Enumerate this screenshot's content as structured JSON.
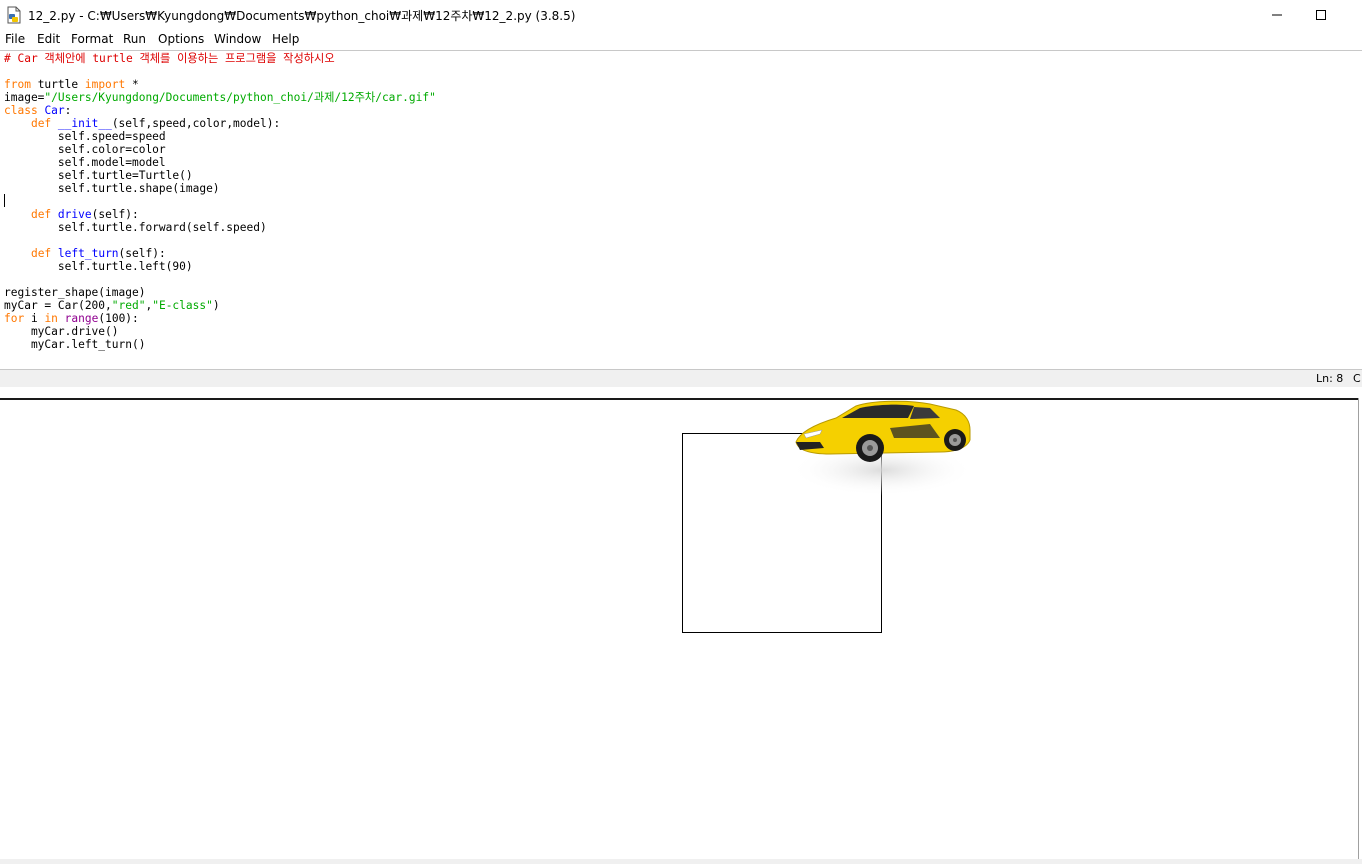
{
  "window": {
    "title": "12_2.py - C:₩Users₩Kyungdong₩Documents₩python_choi₩과제₩12주차₩12_2.py (3.8.5)",
    "minimize_symbol": "—",
    "maximize_symbol": "☐"
  },
  "menu": {
    "items": [
      "File",
      "Edit",
      "Format",
      "Run",
      "Options",
      "Window",
      "Help"
    ]
  },
  "code": {
    "lines": [
      "# Car 객체안에 turtle 객체를 이용하는 프로그램을 작성하시오",
      "",
      "from turtle import *",
      "image=\"/Users/Kyungdong/Documents/python_choi/과제/12주차/car.gif\"",
      "class Car:",
      "    def __init__(self,speed,color,model):",
      "        self.speed=speed",
      "        self.color=color",
      "        self.model=model",
      "        self.turtle=Turtle()",
      "        self.turtle.shape(image)",
      "",
      "    def drive(self):",
      "        self.turtle.forward(self.speed)",
      "",
      "    def left_turn(self):",
      "        self.turtle.left(90)",
      "",
      "register_shape(image)",
      "myCar = Car(200,\"red\",\"E-class\")",
      "for i in range(100):",
      "    myCar.drive()",
      "    myCar.left_turn()"
    ]
  },
  "status": {
    "line": "Ln: 8",
    "col": "C"
  },
  "colors": {
    "keyword": "#ff7700",
    "string": "#00aa00",
    "comment": "#dd0000",
    "definition": "#0000ff",
    "builtin": "#900090",
    "car": "#f5d000"
  }
}
